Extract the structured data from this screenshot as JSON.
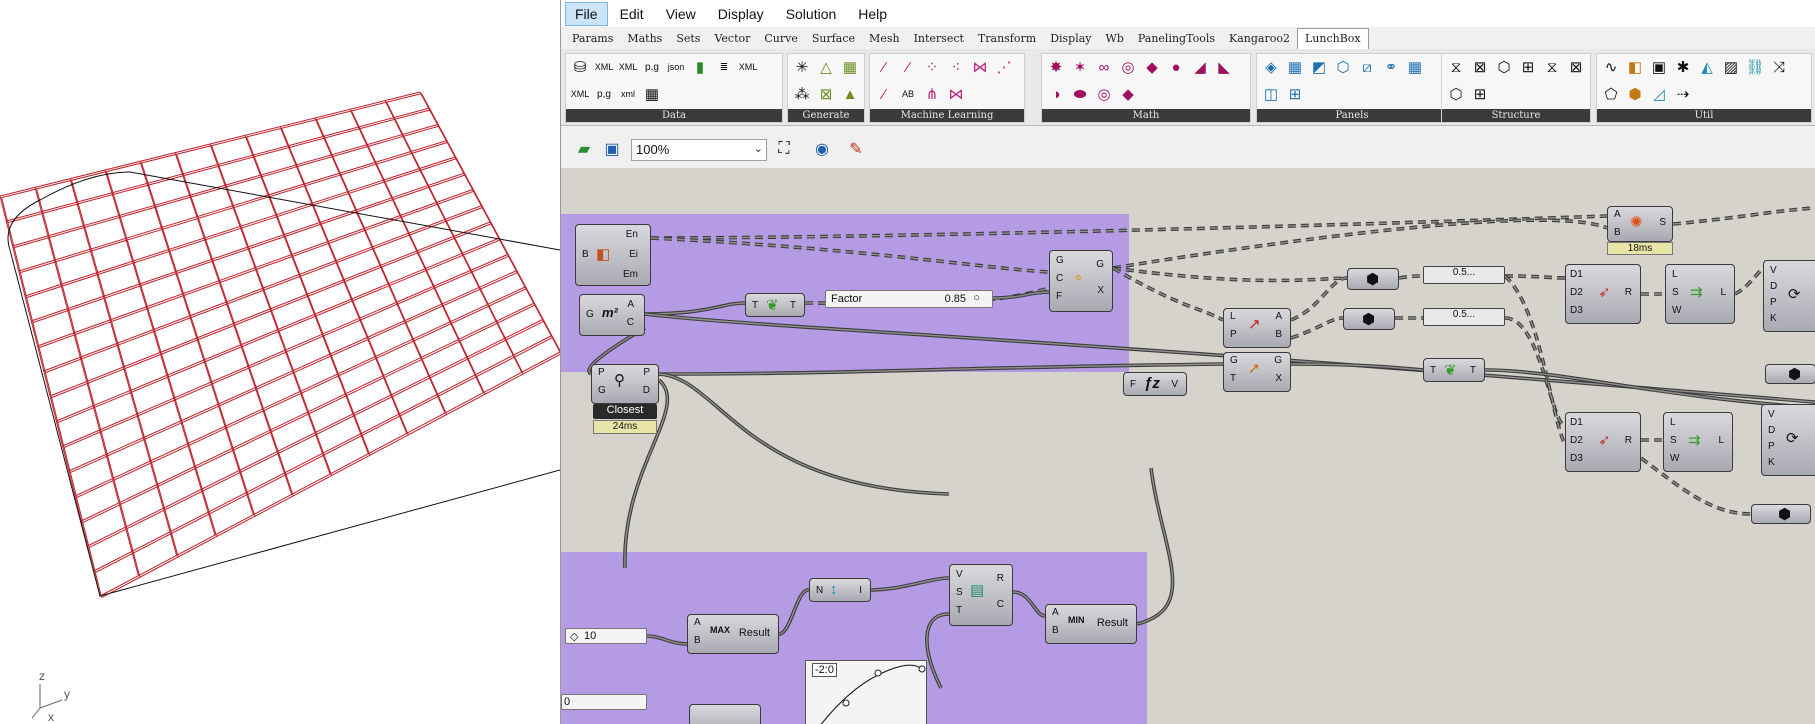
{
  "menu": [
    "File",
    "Edit",
    "View",
    "Display",
    "Solution",
    "Help"
  ],
  "tabs": [
    "Params",
    "Maths",
    "Sets",
    "Vector",
    "Curve",
    "Surface",
    "Mesh",
    "Intersect",
    "Transform",
    "Display",
    "Wb",
    "PanelingTools",
    "Kangaroo2",
    "LunchBox"
  ],
  "ribbon_groups": [
    "Data",
    "Generate",
    "Machine Learning",
    "Math",
    "Panels",
    "Structure",
    "Util"
  ],
  "toolbar": {
    "zoom": "100%"
  },
  "viewport": {
    "axis_x": "x",
    "axis_y": "y",
    "axis_z": "z"
  },
  "canvas": {
    "comp_box": {
      "in": [
        "B"
      ],
      "out": [
        "En",
        "Ei",
        "Em"
      ]
    },
    "comp_area": {
      "in": [
        "G"
      ],
      "icon": "m²",
      "out": [
        "A",
        "C"
      ]
    },
    "comp_graft1": {
      "in": "T",
      "out": "T"
    },
    "comp_bounds": {
      "in": [
        "G",
        "C",
        "F"
      ],
      "out": [
        "G",
        "X"
      ]
    },
    "factor_slider": {
      "label": "Factor",
      "value": "0.85"
    },
    "comp_closest": {
      "in": [
        "P",
        "G"
      ],
      "out": [
        "P",
        "D"
      ],
      "caption": "Closest",
      "timer": "24ms"
    },
    "comp_lunch": {
      "in": [
        "A",
        "B"
      ],
      "out": [
        "S"
      ],
      "timer": "18ms"
    },
    "comp_evaluate": {
      "in": [
        "L",
        "P"
      ],
      "out": [
        "A",
        "B"
      ]
    },
    "panel_a": "0.5...",
    "panel_b": "0.5...",
    "comp_ml1": {
      "in": [
        "D1",
        "D2",
        "D3"
      ],
      "out": [
        "R"
      ]
    },
    "comp_ml2": {
      "in": [
        "D1",
        "D2",
        "D3"
      ],
      "out": [
        "R"
      ]
    },
    "comp_list1": {
      "in": [
        "L",
        "S",
        "W"
      ],
      "out": [
        "L"
      ]
    },
    "comp_list2": {
      "in": [
        "L",
        "S",
        "W"
      ],
      "out": [
        "L"
      ]
    },
    "comp_fn": {
      "in": "F",
      "out": "V"
    },
    "comp_move": {
      "in": [
        "G",
        "T"
      ],
      "out": [
        "G",
        "X"
      ]
    },
    "comp_graft2": {
      "in": "T",
      "out": "T"
    },
    "comp_right1": {
      "in": [
        "V",
        "D",
        "P",
        "K"
      ]
    },
    "comp_right2": {
      "in": [
        "V",
        "D",
        "P",
        "K"
      ]
    },
    "comp_max": {
      "in": [
        "A",
        "B"
      ],
      "label": "Result"
    },
    "comp_bounds2": {
      "in": "N",
      "out": "I"
    },
    "comp_sub": {
      "in": [
        "V",
        "S",
        "T"
      ],
      "out": [
        "R",
        "C"
      ]
    },
    "comp_min": {
      "in": [
        "A",
        "B"
      ],
      "label": "Result"
    },
    "slider_10": {
      "value": "10"
    },
    "slider_0": {
      "value": "0"
    },
    "graph_label": "-2:0"
  }
}
